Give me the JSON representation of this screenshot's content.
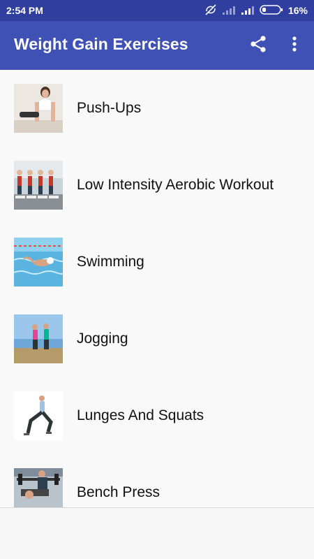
{
  "status_bar": {
    "time": "2:54 PM",
    "battery": "16%",
    "icons": [
      "sync-off-icon",
      "signal-weak-icon",
      "signal-icon",
      "battery-icon"
    ]
  },
  "app_bar": {
    "title": "Weight Gain Exercises",
    "actions": [
      "share-icon",
      "more-vert-icon"
    ],
    "color": "#3f51b5",
    "status_color": "#303f9f"
  },
  "exercises": [
    {
      "label": "Push-Ups"
    },
    {
      "label": "Low Intensity Aerobic Workout"
    },
    {
      "label": "Swimming"
    },
    {
      "label": "Jogging"
    },
    {
      "label": "Lunges And Squats"
    },
    {
      "label": "Bench Press"
    }
  ]
}
